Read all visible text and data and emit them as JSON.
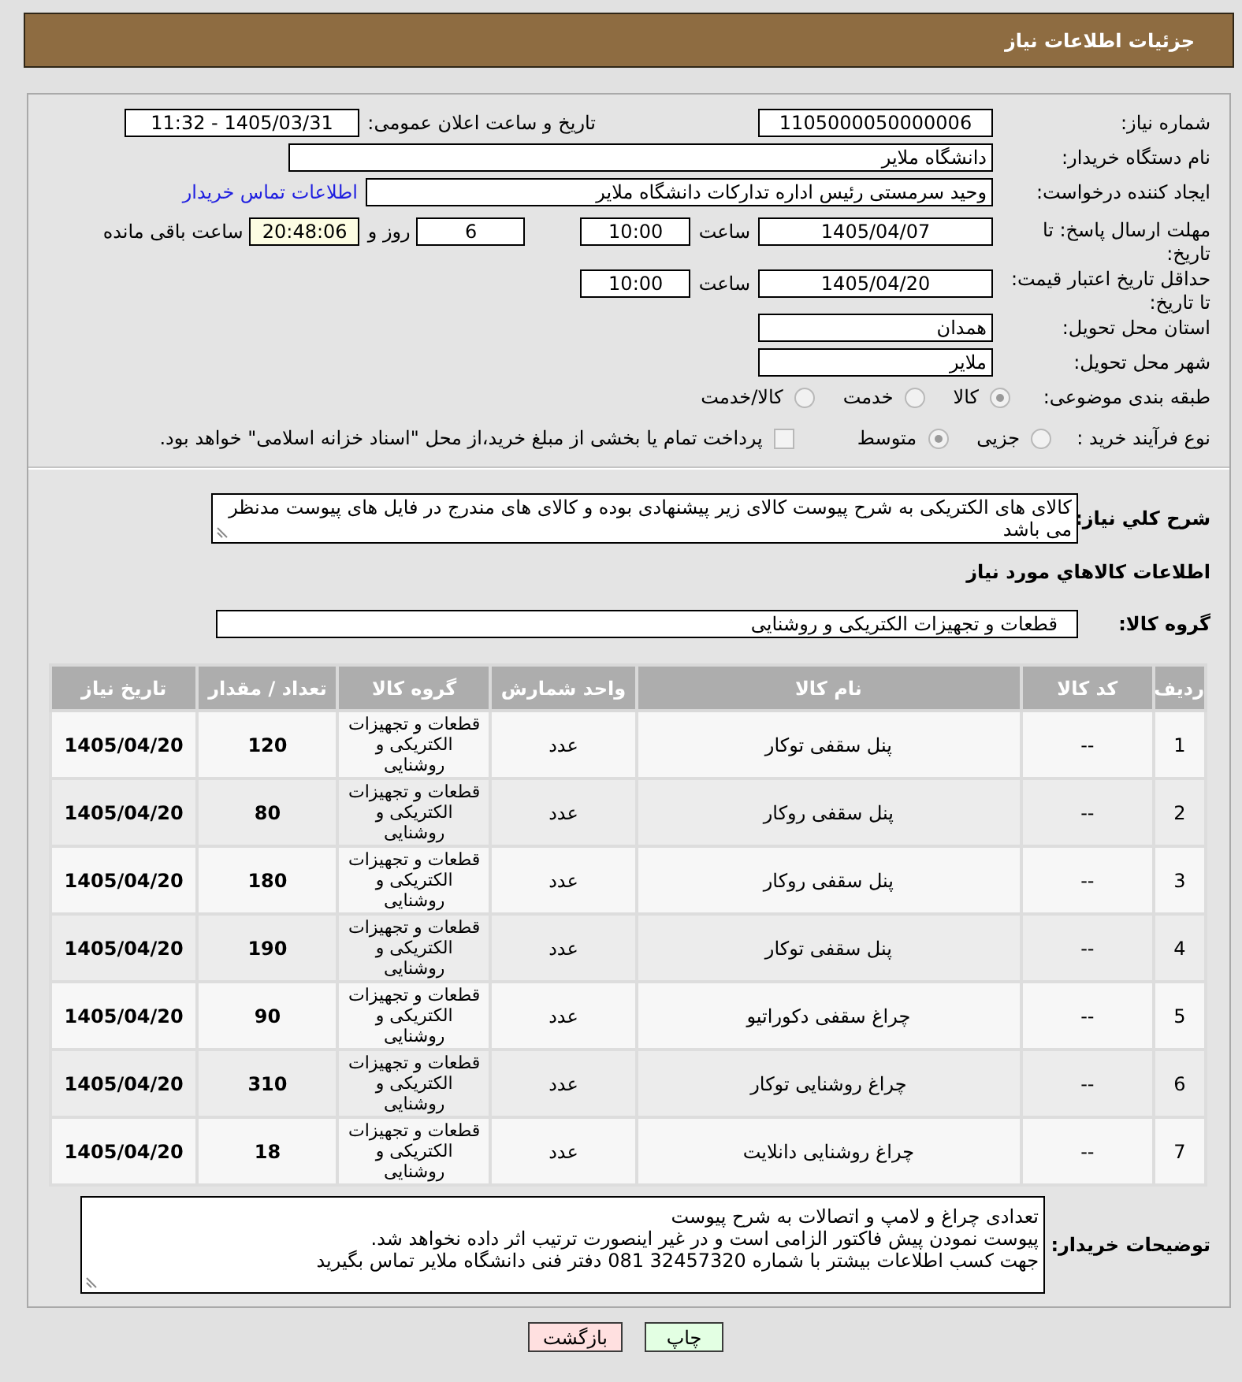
{
  "header": {
    "title": "جزئیات اطلاعات نیاز"
  },
  "form": {
    "need_number": {
      "label": "شماره نیاز:",
      "value": "1105000050000006"
    },
    "announce": {
      "label": "تاریخ و ساعت اعلان عمومی:",
      "value": "1405/03/31 - 11:32"
    },
    "buyer_org": {
      "label": "نام دستگاه خریدار:",
      "value": "دانشگاه ملایر"
    },
    "requester": {
      "label": "ایجاد کننده درخواست:",
      "value": "وحید سرمستی رئیس اداره تدارکات دانشگاه ملایر",
      "link": "اطلاعات تماس خریدار"
    },
    "deadline": {
      "label": "مهلت ارسال پاسخ: تا تاریخ:",
      "date": "1405/04/07",
      "time_label": "ساعت",
      "time": "10:00",
      "days": "6",
      "days_label": "روز و",
      "remaining": "20:48:06",
      "remaining_label": "ساعت باقی مانده"
    },
    "price_validity": {
      "label": "حداقل تاریخ اعتبار قیمت: تا تاریخ:",
      "date": "1405/04/20",
      "time_label": "ساعت",
      "time": "10:00"
    },
    "province": {
      "label": "استان محل تحویل:",
      "value": "همدان"
    },
    "city": {
      "label": "شهر محل تحویل:",
      "value": "ملایر"
    },
    "category": {
      "label": "طبقه بندی موضوعی:",
      "options": [
        {
          "label": "کالا",
          "selected": true
        },
        {
          "label": "خدمت",
          "selected": false
        },
        {
          "label": "کالا/خدمت",
          "selected": false
        }
      ]
    },
    "process": {
      "label": "نوع فرآیند خرید :",
      "options": [
        {
          "label": "جزیی",
          "selected": false
        },
        {
          "label": "متوسط",
          "selected": true
        }
      ],
      "treasury": {
        "label": "پرداخت تمام یا بخشی از مبلغ خرید،از محل \"اسناد خزانه اسلامی\" خواهد بود.",
        "checked": false
      }
    }
  },
  "description": {
    "label": "شرح کلي نیاز:",
    "value": "کالای های الکتریکی به شرح پیوست کالای زیر پیشنهادی بوده و کالای های مندرج در فایل های پیوست مدنظر می باشد"
  },
  "goods_title": "اطلاعات کالاهاي مورد نیاز",
  "goods_group": {
    "label": "گروه کالا:",
    "value": "قطعات و تجهیزات الکتریکی و روشنایی"
  },
  "table": {
    "columns": [
      "ردیف",
      "کد کالا",
      "نام کالا",
      "واحد شمارش",
      "گروه کالا",
      "تعداد / مقدار",
      "تاریخ نیاز"
    ],
    "rows": [
      {
        "row": "1",
        "code": "--",
        "name": "پنل سقفی توکار",
        "unit": "عدد",
        "group": "قطعات و تجهیزات الکتریکی و روشنایی",
        "quantity": "120",
        "date": "1405/04/20"
      },
      {
        "row": "2",
        "code": "--",
        "name": "پنل سقفی روکار",
        "unit": "عدد",
        "group": "قطعات و تجهیزات الکتریکی و روشنایی",
        "quantity": "80",
        "date": "1405/04/20"
      },
      {
        "row": "3",
        "code": "--",
        "name": "پنل سقفی روکار",
        "unit": "عدد",
        "group": "قطعات و تجهیزات الکتریکی و روشنایی",
        "quantity": "180",
        "date": "1405/04/20"
      },
      {
        "row": "4",
        "code": "--",
        "name": "پنل سقفی توکار",
        "unit": "عدد",
        "group": "قطعات و تجهیزات الکتریکی و روشنایی",
        "quantity": "190",
        "date": "1405/04/20"
      },
      {
        "row": "5",
        "code": "--",
        "name": "چراغ سقفی دکوراتیو",
        "unit": "عدد",
        "group": "قطعات و تجهیزات الکتریکی و روشنایی",
        "quantity": "90",
        "date": "1405/04/20"
      },
      {
        "row": "6",
        "code": "--",
        "name": "چراغ روشنایی توکار",
        "unit": "عدد",
        "group": "قطعات و تجهیزات الکتریکی و روشنایی",
        "quantity": "310",
        "date": "1405/04/20"
      },
      {
        "row": "7",
        "code": "--",
        "name": "چراغ روشنایی دانلایت",
        "unit": "عدد",
        "group": "قطعات و تجهیزات الکتریکی و روشنایی",
        "quantity": "18",
        "date": "1405/04/20"
      }
    ]
  },
  "buyer_notes": {
    "label": "توضیحات خریدار:",
    "value": "تعدادی چراغ و لامپ و اتصالات به شرح پیوست\nپیوست نمودن پیش فاکتور الزامی است و در غیر اینصورت ترتیب اثر داده نخواهد شد.\nجهت کسب اطلاعات بیشتر با شماره 32457320 081 دفتر فنی دانشگاه ملایر تماس بگیرید"
  },
  "buttons": {
    "print": "چاپ",
    "back": "بازگشت"
  }
}
